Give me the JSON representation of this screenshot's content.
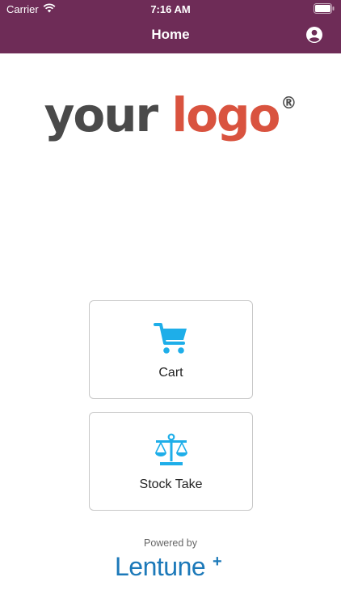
{
  "status_bar": {
    "carrier": "Carrier",
    "time": "7:16 AM",
    "icons": [
      "wifi-icon",
      "battery-icon"
    ]
  },
  "nav": {
    "title": "Home",
    "right_icon": "profile-icon",
    "brand_color": "#6e2c57"
  },
  "logo": {
    "word1": "your",
    "word2": "logo",
    "mark": "®"
  },
  "menu": [
    {
      "label": "Cart",
      "icon": "shopping-cart-icon"
    },
    {
      "label": "Stock Take",
      "icon": "scales-icon"
    }
  ],
  "footer": {
    "powered_by": "Powered by",
    "brand": "Lentune",
    "brand_mark": "+",
    "brand_color": "#1c79b9"
  },
  "colors": {
    "icon_accent": "#1eaee9",
    "logo_grey": "#4a4a4a",
    "logo_red": "#d9533f"
  }
}
